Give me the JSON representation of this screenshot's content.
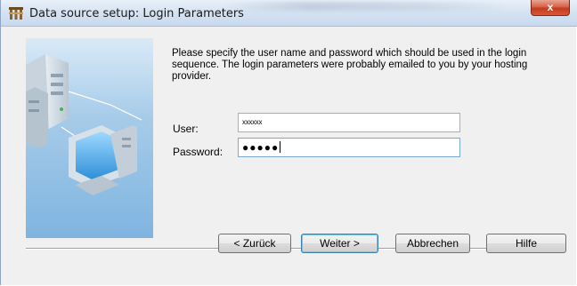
{
  "window": {
    "title": "Data source setup: Login Parameters",
    "close_symbol": "x"
  },
  "intro": {
    "text": "Please specify the user name and password which should be used in the login sequence. The login parameters were probably emailed to you by your hosting provider."
  },
  "form": {
    "user_label": "User:",
    "user_value": "xxxxxx",
    "password_label": "Password:",
    "password_value": "●●●●●"
  },
  "buttons": {
    "back": "< Zurück",
    "next": "Weiter >",
    "cancel": "Abbrechen",
    "help": "Hilfe"
  },
  "icons": {
    "app": "app-icon",
    "side": "servers-network-illustration",
    "close": "close-icon"
  },
  "colors": {
    "accent": "#3c7fb1",
    "close_button": "#c43b1f",
    "panel_art": "#7fb4e0"
  }
}
